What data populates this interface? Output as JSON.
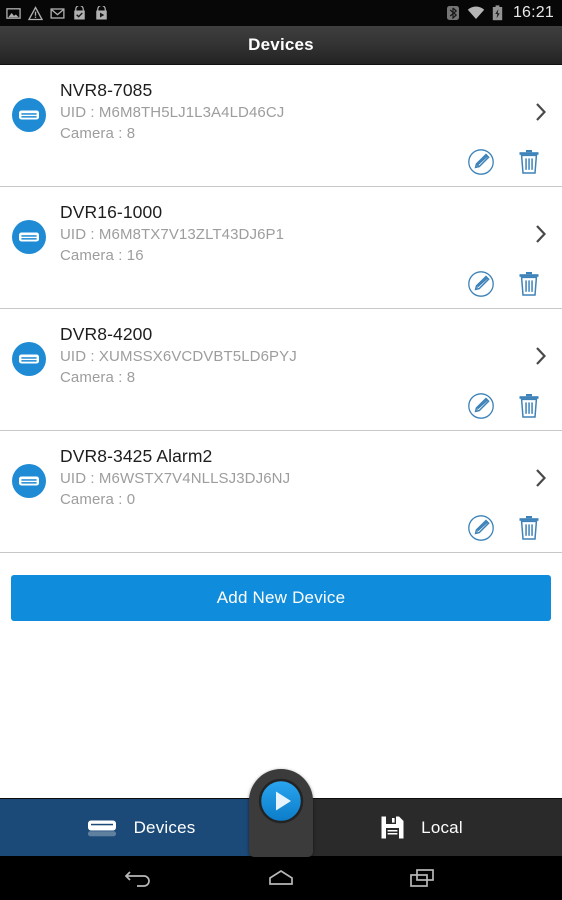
{
  "statusbar": {
    "time": "16:21",
    "left_icons": [
      "image-icon",
      "warning-icon",
      "gmail-icon",
      "app-install-icon",
      "play-store-icon"
    ],
    "right_icons": [
      "bluetooth-icon",
      "wifi-icon",
      "battery-charging-icon"
    ]
  },
  "titlebar": {
    "title": "Devices"
  },
  "devices": [
    {
      "name": "NVR8-7085",
      "uid": "UID : M6M8TH5LJ1L3A4LD46CJ",
      "camera": "Camera : 8",
      "edit_label": "Edit",
      "delete_label": "Delete"
    },
    {
      "name": "DVR16-1000",
      "uid": "UID : M6M8TX7V13ZLT43DJ6P1",
      "camera": "Camera : 16",
      "edit_label": "Edit",
      "delete_label": "Delete"
    },
    {
      "name": "DVR8-4200",
      "uid": "UID : XUMSSX6VCDVBT5LD6PYJ",
      "camera": "Camera : 8",
      "edit_label": "Edit",
      "delete_label": "Delete"
    },
    {
      "name": "DVR8-3425 Alarm2",
      "uid": "UID : M6WSTX7V4NLLSJ3DJ6NJ",
      "camera": "Camera : 0",
      "edit_label": "Edit",
      "delete_label": "Delete"
    }
  ],
  "add_button": {
    "label": "Add New Device"
  },
  "tabbar": {
    "devices_label": "Devices",
    "local_label": "Local",
    "play_label": "Play"
  },
  "navbar": {
    "back_label": "Back",
    "home_label": "Home",
    "recents_label": "Recents"
  },
  "colors": {
    "accent_blue": "#0f8cdb",
    "active_tab_blue": "#1c4a78",
    "device_icon_blue": "#1e8bd4",
    "action_icon_blue": "#3d82b8",
    "muted_text": "#9d9d9d"
  }
}
